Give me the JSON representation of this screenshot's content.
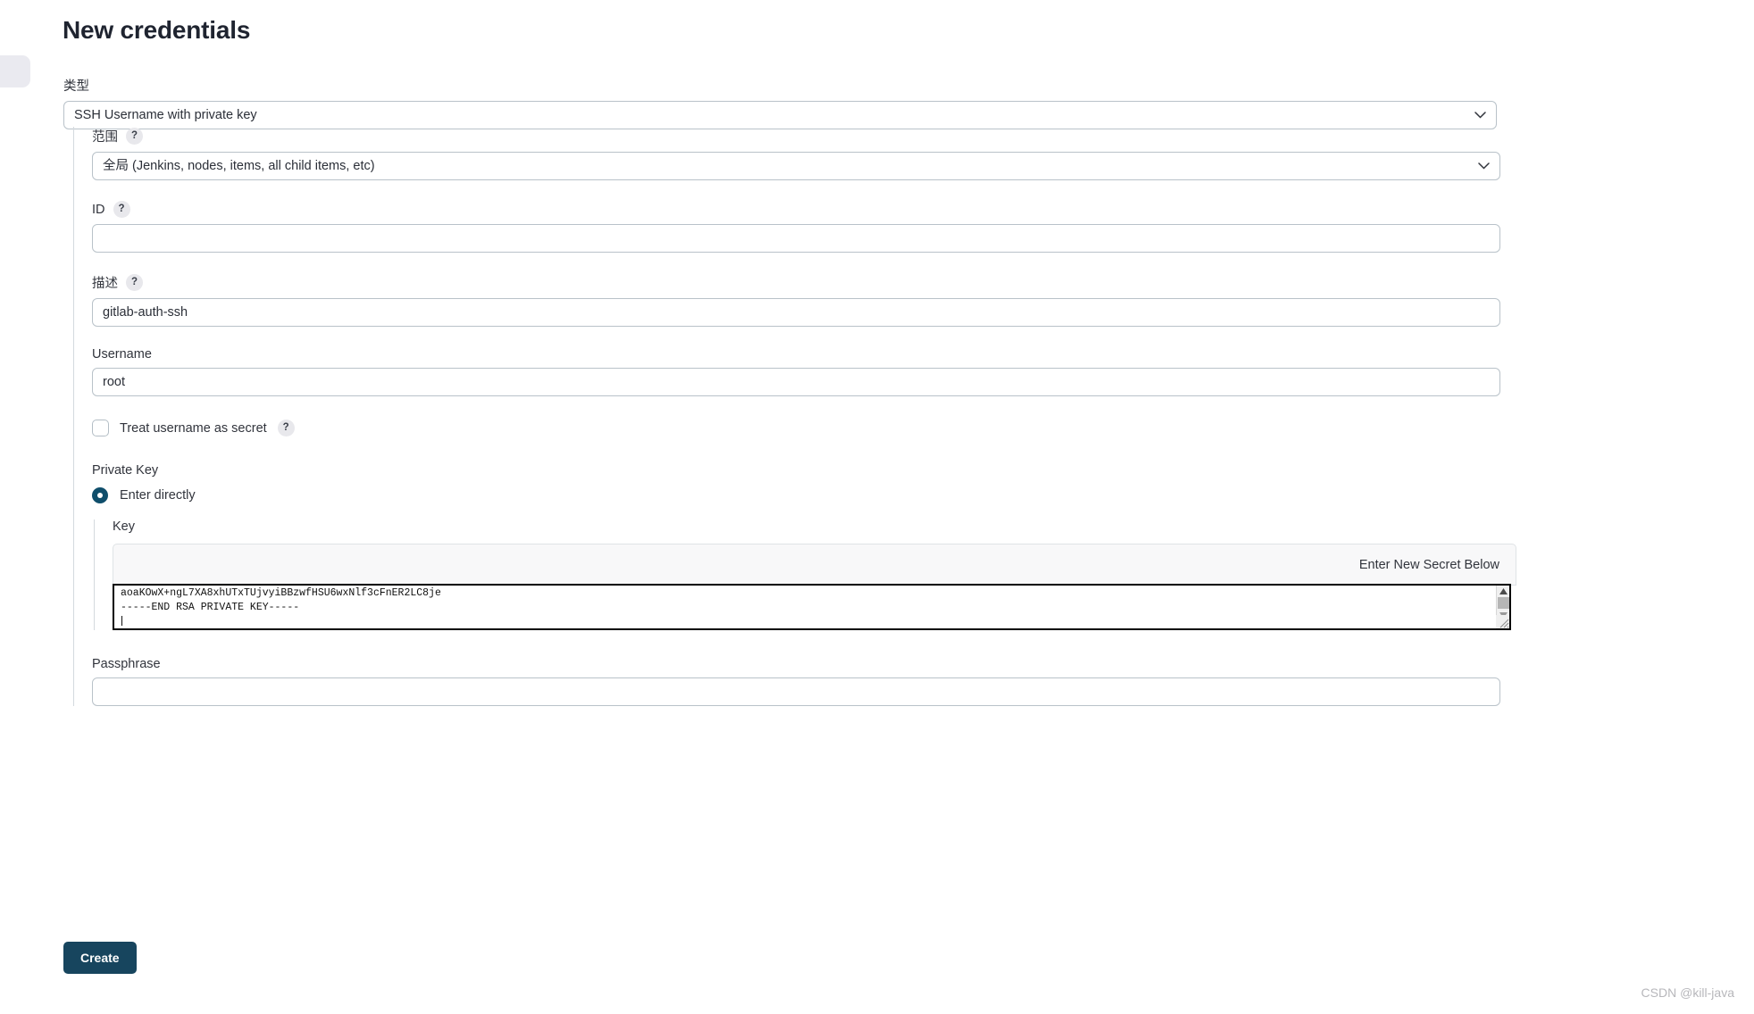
{
  "page": {
    "title": "New credentials",
    "watermark": "CSDN @kill-java"
  },
  "icons": {
    "help": "?",
    "chevron_down": "chevron-down-icon",
    "scroll_up": "▲",
    "scroll_down": "▼"
  },
  "type_field": {
    "label": "类型",
    "value": "SSH Username with private key"
  },
  "scope_field": {
    "label": "范围",
    "help": "?",
    "value": "全局 (Jenkins, nodes, items, all child items, etc)"
  },
  "id_field": {
    "label": "ID",
    "help": "?",
    "value": "",
    "placeholder": ""
  },
  "description_field": {
    "label": "描述",
    "help": "?",
    "value": "gitlab-auth-ssh"
  },
  "username_field": {
    "label": "Username",
    "value": "root"
  },
  "treat_secret": {
    "label": "Treat username as secret",
    "help": "?",
    "checked": false
  },
  "private_key": {
    "label": "Private Key",
    "option_label": "Enter directly",
    "selected": true,
    "key": {
      "label": "Key",
      "secret_header": "Enter New Secret Below",
      "value_line1": "aoaKOwX+ngL7XA8xhUTxTUjvyiBBzwfHSU6wxNlf3cFnER2LC8je",
      "value_line2": "-----END RSA PRIVATE KEY-----"
    }
  },
  "passphrase_field": {
    "label": "Passphrase",
    "value": ""
  },
  "actions": {
    "create_label": "Create"
  },
  "colors": {
    "accent": "#17455e",
    "radio_selected": "#0f4e6b",
    "border": "#b9c2c9",
    "panel": "#f8f8f9"
  }
}
